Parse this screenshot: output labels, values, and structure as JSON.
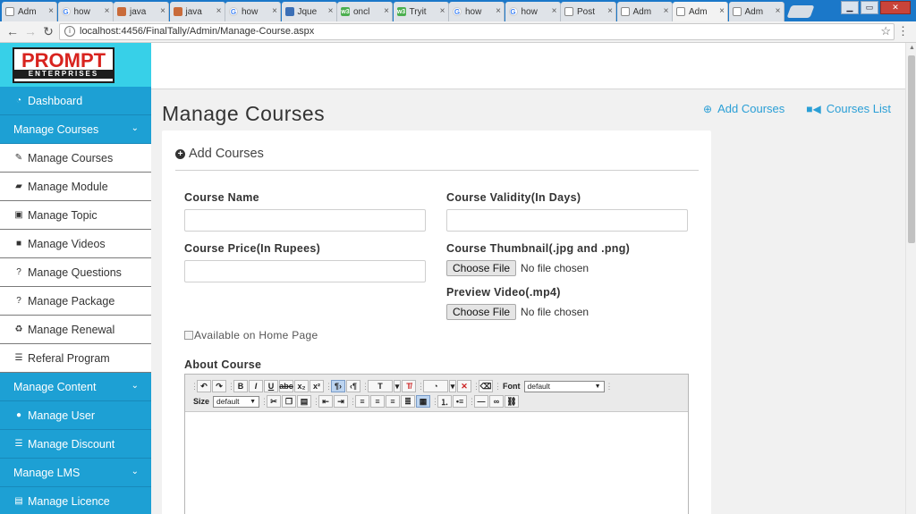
{
  "browser": {
    "tabs": [
      {
        "label": "Adm",
        "icon": "document-icon",
        "kind": "doc",
        "active": false
      },
      {
        "label": "how",
        "icon": "google-icon",
        "kind": "goog",
        "active": false
      },
      {
        "label": "java",
        "icon": "java-icon",
        "kind": "js",
        "active": false
      },
      {
        "label": "java",
        "icon": "java-icon",
        "kind": "js",
        "active": false
      },
      {
        "label": "how",
        "icon": "google-icon",
        "kind": "goog",
        "active": false
      },
      {
        "label": "Jque",
        "icon": "jquery-icon",
        "kind": "jq",
        "active": false
      },
      {
        "label": "oncl",
        "icon": "w3schools-icon",
        "kind": "w3",
        "active": false
      },
      {
        "label": "Tryit",
        "icon": "w3schools-icon",
        "kind": "w3",
        "active": false
      },
      {
        "label": "how",
        "icon": "google-icon",
        "kind": "goog",
        "active": false
      },
      {
        "label": "how",
        "icon": "google-icon",
        "kind": "goog",
        "active": false
      },
      {
        "label": "Post",
        "icon": "document-icon",
        "kind": "doc",
        "active": false
      },
      {
        "label": "Adm",
        "icon": "document-icon",
        "kind": "doc",
        "active": false
      },
      {
        "label": "Adm",
        "icon": "document-icon",
        "kind": "doc",
        "active": true
      },
      {
        "label": "Adm",
        "icon": "document-icon",
        "kind": "doc",
        "active": false
      }
    ],
    "url": "localhost:4456/FinalTally/Admin/Manage-Course.aspx"
  },
  "sidebar": {
    "logo_top": "PROMPT",
    "logo_bottom": "ENTERPRISES",
    "items": [
      {
        "label": "Dashboard",
        "icon": "dashboard-icon",
        "glyph": "◔",
        "style": "primary",
        "chevron": false,
        "name": "sidebar-item-dashboard"
      },
      {
        "label": "Manage Courses",
        "icon": "",
        "glyph": "",
        "style": "primary",
        "chevron": true,
        "name": "sidebar-item-manage-courses"
      },
      {
        "label": "Manage Courses",
        "icon": "edit-icon",
        "glyph": "✎",
        "style": "sub",
        "chevron": false,
        "name": "sidebar-subitem-manage-courses"
      },
      {
        "label": "Manage Module",
        "icon": "briefcase-icon",
        "glyph": "▰",
        "style": "sub",
        "chevron": false,
        "name": "sidebar-subitem-manage-module"
      },
      {
        "label": "Manage Topic",
        "icon": "topic-icon",
        "glyph": "▣",
        "style": "sub",
        "chevron": false,
        "name": "sidebar-subitem-manage-topic"
      },
      {
        "label": "Manage Videos",
        "icon": "video-camera-icon",
        "glyph": "■",
        "style": "sub",
        "chevron": false,
        "name": "sidebar-subitem-manage-videos"
      },
      {
        "label": "Manage Questions",
        "icon": "question-icon",
        "glyph": "?",
        "style": "sub",
        "chevron": false,
        "name": "sidebar-subitem-manage-questions"
      },
      {
        "label": "Manage Package",
        "icon": "question-icon",
        "glyph": "?",
        "style": "sub",
        "chevron": false,
        "name": "sidebar-subitem-manage-package"
      },
      {
        "label": "Manage Renewal",
        "icon": "recycle-icon",
        "glyph": "♻",
        "style": "sub",
        "chevron": false,
        "name": "sidebar-subitem-manage-renewal"
      },
      {
        "label": "Referal Program",
        "icon": "list-icon",
        "glyph": "☰",
        "style": "sub",
        "chevron": false,
        "name": "sidebar-subitem-referal-program"
      },
      {
        "label": "Manage Content",
        "icon": "",
        "glyph": "",
        "style": "primary",
        "chevron": true,
        "name": "sidebar-item-manage-content"
      },
      {
        "label": "Manage User",
        "icon": "user-icon",
        "glyph": "●",
        "style": "primary",
        "chevron": false,
        "name": "sidebar-item-manage-user"
      },
      {
        "label": "Manage Discount",
        "icon": "list-icon",
        "glyph": "☰",
        "style": "primary",
        "chevron": false,
        "name": "sidebar-item-manage-discount"
      },
      {
        "label": "Manage LMS",
        "icon": "",
        "glyph": "",
        "style": "primary",
        "chevron": true,
        "name": "sidebar-item-manage-lms"
      },
      {
        "label": "Manage Licence",
        "icon": "id-card-icon",
        "glyph": "▤",
        "style": "primary",
        "chevron": false,
        "name": "sidebar-item-manage-licence"
      }
    ]
  },
  "header": {
    "title": "Manage Courses",
    "add_courses_link": "Add Courses",
    "courses_list_link": "Courses List"
  },
  "form": {
    "card_title": "Add Courses",
    "course_name_label": "Course Name",
    "course_name_value": "",
    "course_validity_label": "Course Validity(In Days)",
    "course_validity_value": "",
    "course_price_label": "Course Price(In Rupees)",
    "course_price_value": "",
    "thumbnail_label": "Course Thumbnail(.jpg and .png)",
    "preview_video_label": "Preview Video(.mp4)",
    "choose_file_label": "Choose File",
    "no_file_text": "No file chosen",
    "available_label": "Available on Home Page",
    "available_checked": false,
    "about_label": "About Course"
  },
  "editor": {
    "font_label": "Font",
    "font_value": "default",
    "size_label": "Size",
    "size_value": "default"
  },
  "colors": {
    "sidebar_primary": "#1da0d4",
    "logo_bg": "#37d0e8",
    "link": "#2a9fd6",
    "logo_red": "#d8231e"
  }
}
